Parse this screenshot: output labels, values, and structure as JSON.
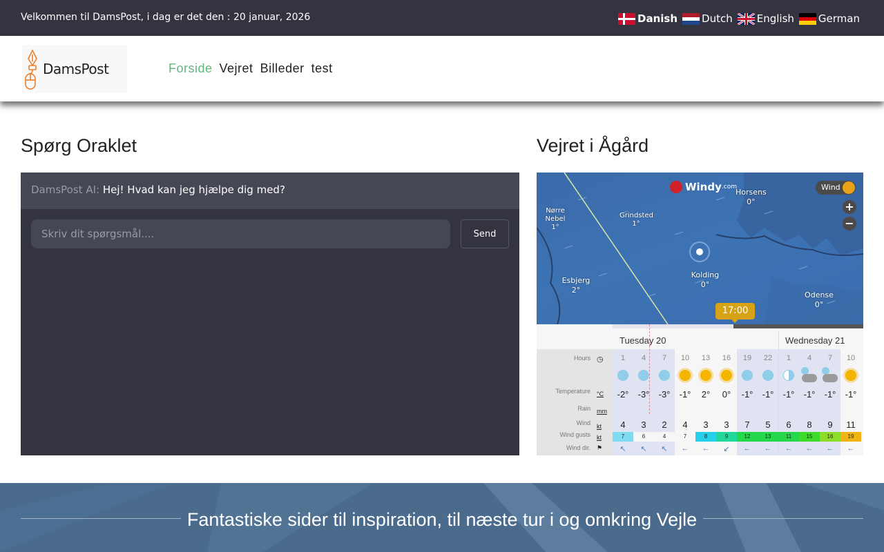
{
  "topbar": {
    "welcome": "Velkommen til DamsPost, i dag er det den : 20 januar, 2026",
    "languages": [
      {
        "label": "Danish",
        "active": true
      },
      {
        "label": "Dutch",
        "active": false
      },
      {
        "label": "English",
        "active": false
      },
      {
        "label": "German",
        "active": false
      }
    ]
  },
  "header": {
    "logo_text": "DamsPost",
    "nav": [
      "Forside",
      "Vejret",
      "Billeder",
      "test"
    ]
  },
  "oracle": {
    "title": "Spørg Oraklet",
    "bot_name": "DamsPost AI:",
    "bot_message": "Hej! Hvad kan jeg hjælpe dig med?",
    "input_placeholder": "Skriv dit spørgsmål....",
    "send_label": "Send"
  },
  "weather": {
    "title": "Vejret i Ågård",
    "map": {
      "brand": "Windy",
      "brand_suffix": ".com",
      "layer": "Wind",
      "zoom_in": "+",
      "zoom_out": "−",
      "time": "17:00",
      "places": [
        {
          "name": "Horsens",
          "temp": "0°"
        },
        {
          "name": "Nørre Nebel",
          "temp": "1°"
        },
        {
          "name": "Grindsted",
          "temp": "1°"
        },
        {
          "name": "Esbjerg",
          "temp": "2°"
        },
        {
          "name": "Kolding",
          "temp": "0°"
        },
        {
          "name": "Odense",
          "temp": "0°"
        }
      ]
    },
    "days": [
      "Tuesday 20",
      "Wednesday 21"
    ],
    "row_labels": {
      "hours": "Hours",
      "temperature": "Temperature",
      "temperature_unit": "°C",
      "rain": "Rain",
      "rain_unit": "mm",
      "wind": "Wind",
      "wind_unit": "kt",
      "gusts": "Wind gusts",
      "gusts_unit": "kt",
      "dir": "Wind dir."
    },
    "forecast": [
      {
        "hour": "1",
        "icon": "clear-night",
        "temp": "-2°",
        "wind": "4",
        "gust": "7",
        "gust_color": "#7fdcf0"
      },
      {
        "hour": "4",
        "icon": "clear-night",
        "temp": "-3°",
        "wind": "3",
        "gust": "6",
        "gust_color": "#f6f6f6"
      },
      {
        "hour": "7",
        "icon": "clear-night",
        "temp": "-3°",
        "wind": "2",
        "gust": "4",
        "gust_color": "#f6f6f6"
      },
      {
        "hour": "10",
        "icon": "sun",
        "temp": "-1°",
        "wind": "4",
        "gust": "7",
        "gust_color": "#f6f6f6"
      },
      {
        "hour": "13",
        "icon": "sun",
        "temp": "2°",
        "wind": "3",
        "gust": "8",
        "gust_color": "#26d0e8"
      },
      {
        "hour": "16",
        "icon": "sun",
        "temp": "0°",
        "wind": "3",
        "gust": "9",
        "gust_color": "#1fd89a"
      },
      {
        "hour": "19",
        "icon": "clear-night",
        "temp": "-1°",
        "wind": "7",
        "gust": "12",
        "gust_color": "#25d84b"
      },
      {
        "hour": "22",
        "icon": "clear-night",
        "temp": "-1°",
        "wind": "5",
        "gust": "13",
        "gust_color": "#25d84b"
      },
      {
        "hour": "1",
        "icon": "half-moon",
        "temp": "-1°",
        "wind": "6",
        "gust": "11",
        "gust_color": "#25d84b"
      },
      {
        "hour": "4",
        "icon": "cloud-night",
        "temp": "-1°",
        "wind": "8",
        "gust": "15",
        "gust_color": "#3edc2a"
      },
      {
        "hour": "7",
        "icon": "cloud-night",
        "temp": "-1°",
        "wind": "9",
        "gust": "16",
        "gust_color": "#8edc2a"
      },
      {
        "hour": "10",
        "icon": "sun",
        "temp": "-1°",
        "wind": "11",
        "gust": "19",
        "gust_color": "#f0b416"
      }
    ]
  },
  "footer": {
    "title": "Fantastiske sider til inspiration, til næste tur i og omkring Vejle"
  }
}
